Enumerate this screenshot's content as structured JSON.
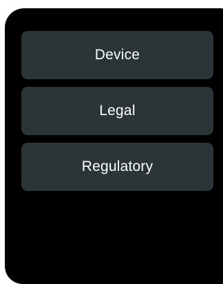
{
  "menu": {
    "items": [
      {
        "label": "Device"
      },
      {
        "label": "Legal"
      },
      {
        "label": "Regulatory"
      }
    ]
  },
  "colors": {
    "screen_background": "#000000",
    "item_background": "#2b3538",
    "item_text": "#ffffff"
  }
}
